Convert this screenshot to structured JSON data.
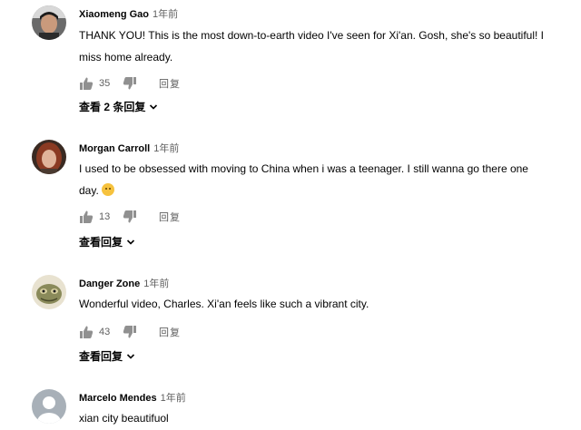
{
  "comments": [
    {
      "author": "Xiaomeng Gao",
      "time": "1年前",
      "text": "THANK YOU! This is the most down-to-earth video I've seen for Xi'an. Gosh, she's so beautiful! I miss home already.",
      "likes": "35",
      "reply_label": "回复",
      "view_replies": "查看 2 条回复",
      "avatar": "person-dark-hair"
    },
    {
      "author": "Morgan Carroll",
      "time": "1年前",
      "text": "I used to be obsessed with moving to China when i was a teenager. I still wanna go there one day.",
      "likes": "13",
      "reply_label": "回复",
      "view_replies": "查看回复",
      "avatar": "person-red-hair",
      "emoji": "smiling-face-emoji"
    },
    {
      "author": "Danger Zone",
      "time": "1年前",
      "text": "Wonderful video, Charles. Xi'an feels like such a vibrant city.",
      "likes": "43",
      "reply_label": "回复",
      "view_replies": "查看回复",
      "avatar": "creature-green"
    },
    {
      "author": "Marcelo Mendes",
      "time": "1年前",
      "text": "xian city beautifuol",
      "avatar": "default-gray-person"
    }
  ],
  "colors": {
    "author": "#030303",
    "meta": "#606060",
    "icon": "#909090"
  }
}
